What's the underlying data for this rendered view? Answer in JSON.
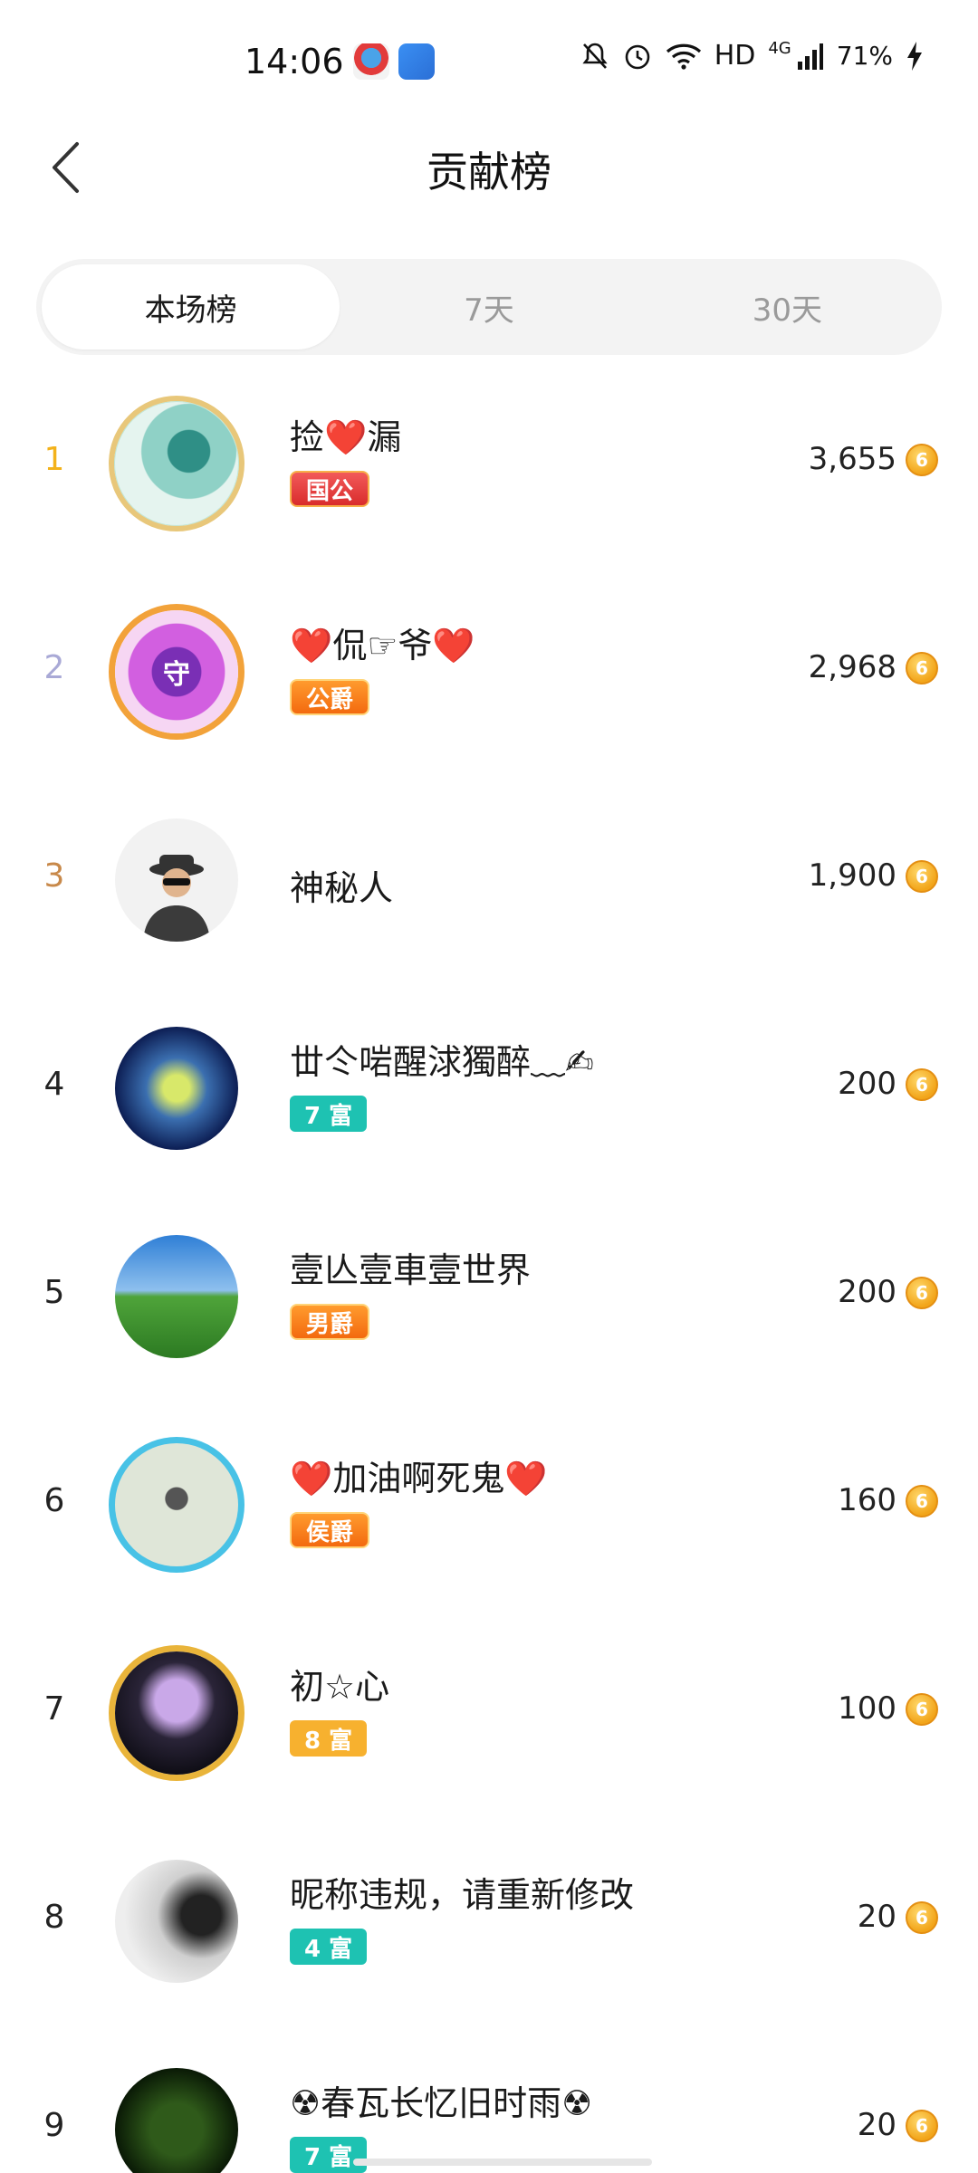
{
  "status_bar": {
    "time": "14:06",
    "network": "HD",
    "signal_label": "4G",
    "battery": "71%",
    "icons": [
      "mute-bell-icon",
      "alarm-icon",
      "wifi-icon",
      "signal-icon",
      "charging-icon"
    ]
  },
  "header": {
    "title": "贡献榜",
    "back_icon": "chevron-left-icon"
  },
  "tabs": [
    {
      "label": "本场榜",
      "active": true
    },
    {
      "label": "7天",
      "active": false
    },
    {
      "label": "30天",
      "active": false
    }
  ],
  "ranking": [
    {
      "rank": "1",
      "name": "捡❤️漏",
      "badge": "国公",
      "badge_style": "red",
      "score": "3,655"
    },
    {
      "rank": "2",
      "name": "❤️侃☞爷❤️",
      "badge": "公爵",
      "badge_style": "orange",
      "score": "2,968"
    },
    {
      "rank": "3",
      "name": "神秘人",
      "badge": "",
      "badge_style": "",
      "score": "1,900"
    },
    {
      "rank": "4",
      "name": "丗仒啱醒浗獨醉﹏✍",
      "badge": "7 富",
      "badge_style": "teal",
      "score": "200"
    },
    {
      "rank": "5",
      "name": "壹亾壹車壹世界",
      "badge": "男爵",
      "badge_style": "orange",
      "score": "200"
    },
    {
      "rank": "6",
      "name": "❤️加油啊死鬼❤️",
      "badge": "侯爵",
      "badge_style": "orange",
      "score": "160"
    },
    {
      "rank": "7",
      "name": "初☆心",
      "badge": "8 富",
      "badge_style": "amber",
      "score": "100"
    },
    {
      "rank": "8",
      "name": "昵称违规，请重新修改",
      "badge": "4 富",
      "badge_style": "teal",
      "score": "20"
    },
    {
      "rank": "9",
      "name": "☢春瓦长忆旧时雨☢",
      "badge": "7 富",
      "badge_style": "teal",
      "score": "20"
    }
  ],
  "coin_icon": "coin-icon",
  "colors": {
    "rank1": "#f3b21b",
    "rank2": "#a9a9d6",
    "rank3": "#c8894a",
    "tab_bg": "#f3f3f3",
    "badge_teal": "#1ec2b2",
    "badge_amber": "#f7b12f"
  }
}
